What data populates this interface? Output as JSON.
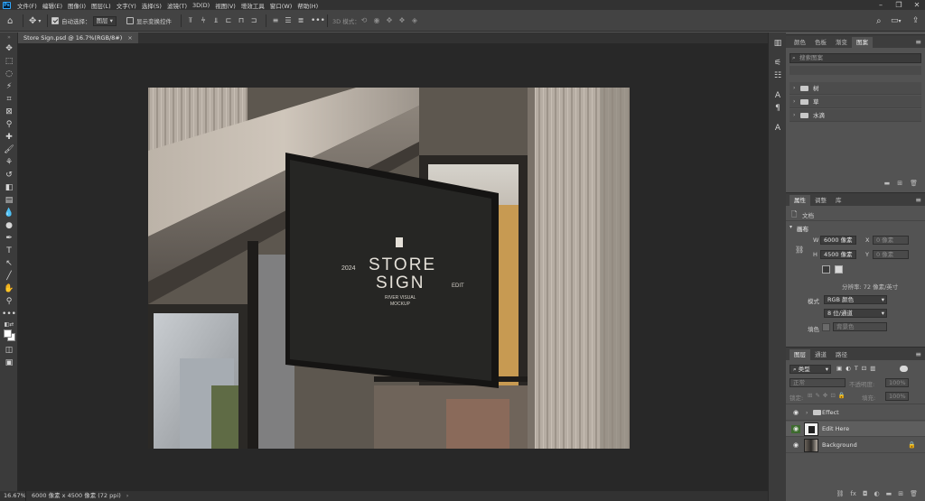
{
  "menubar": {
    "app_icon": "Ps",
    "items": [
      "文件(F)",
      "编辑(E)",
      "图像(I)",
      "图层(L)",
      "文字(Y)",
      "选择(S)",
      "滤镜(T)",
      "3D(D)",
      "视图(V)",
      "增效工具",
      "窗口(W)",
      "帮助(H)"
    ],
    "window_controls": [
      "minimize-icon",
      "restore-icon",
      "close-icon"
    ]
  },
  "options": {
    "auto_select_label": "自动选择：",
    "auto_select_value": "图层",
    "show_transform_label": "显示变换控件",
    "mode_3d_label": "3D 模式："
  },
  "tools": [
    "move-tool",
    "marquee-tool",
    "lasso-tool",
    "magic-wand-tool",
    "crop-tool",
    "frame-tool",
    "eyedropper-tool",
    "healing-tool",
    "brush-tool",
    "clone-stamp-tool",
    "history-brush-tool",
    "eraser-tool",
    "gradient-tool",
    "blur-tool",
    "dodge-tool",
    "pen-tool",
    "type-tool",
    "path-select-tool",
    "line-tool",
    "hand-tool",
    "zoom-tool",
    "more-tools",
    "default-colors",
    "foreground-color",
    "quick-mask",
    "screen-mode"
  ],
  "document": {
    "tab_title": "Store Sign.psd @ 16.7%(RGB/8#)",
    "sign_year": "2024",
    "sign_title_1": "STORE",
    "sign_title_2": "SIGN",
    "sign_edit": "EDIT",
    "sign_sub_1": "RIVER VISUAL",
    "sign_sub_2": "MOCKUP"
  },
  "status": {
    "zoom": "16.67%",
    "info": "6000 像素 x 4500 像素 (72 ppi)"
  },
  "swatches_panel": {
    "tabs": [
      "颜色",
      "色板",
      "渐变",
      "图案"
    ],
    "active_tab": "图案",
    "search_placeholder": "搜索图案",
    "groups": [
      "树",
      "草",
      "水滴"
    ]
  },
  "properties_panel": {
    "tabs": [
      "属性",
      "调整",
      "库"
    ],
    "active_tab": "属性",
    "doc_label": "文档",
    "canvas_section": "画布",
    "w_label": "W",
    "w_value": "6000 像素",
    "h_label": "H",
    "h_value": "4500 像素",
    "x_label": "X",
    "x_value": "0 像素",
    "y_label": "Y",
    "y_value": "0 像素",
    "resolution": "分辨率: 72 像素/英寸",
    "mode_label": "模式",
    "mode_value": "RGB 颜色",
    "depth_value": "8 位/通道",
    "fill_label": "填色",
    "fill_value": "背景色"
  },
  "layers_panel": {
    "tabs": [
      "图层",
      "通道",
      "路径"
    ],
    "active_tab": "图层",
    "filter_value": "类型",
    "blend_mode": "正常",
    "opacity_label": "不透明度:",
    "opacity_value": "100%",
    "lock_label": "锁定:",
    "fill_label": "填充:",
    "fill_value": "100%",
    "layers": [
      {
        "name": "Effect",
        "type": "group"
      },
      {
        "name": "Edit Here",
        "type": "smart"
      },
      {
        "name": "Background",
        "type": "image"
      }
    ]
  },
  "colors": {
    "ui_dark": "#323232",
    "ui_mid": "#535353",
    "canvas_bg": "#282828",
    "eye_highlight": "#3d6b2e",
    "sign_face": "#262624"
  }
}
